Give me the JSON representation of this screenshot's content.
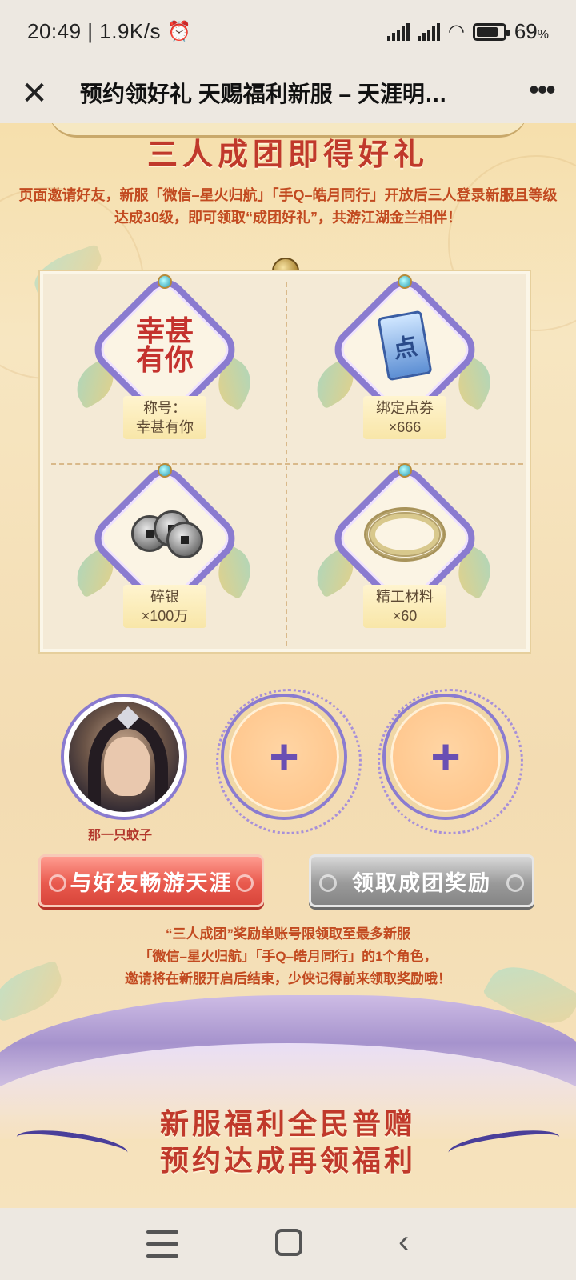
{
  "statusbar": {
    "time_speed": "20:49 | 1.9K/s",
    "alarm_icon": "alarm-clock-icon",
    "battery_pct": "69",
    "battery_unit": "%"
  },
  "navbar": {
    "close_glyph": "✕",
    "title": "预约领好礼 天赐福利新服 – 天涯明…",
    "more_glyph": "•••"
  },
  "page": {
    "section_title": "三人成团即得好礼",
    "description": "页面邀请好友，新服「微信–星火归航」「手Q–皓月同行」开放后三人登录新服且等级达成30级，即可领取“成团好礼”，共游江湖金兰相伴！",
    "rewards": [
      {
        "icon": "title-calligraphy-icon",
        "icon_text": "幸甚\n有你",
        "line1": "称号：",
        "line2": "幸甚有你"
      },
      {
        "icon": "scroll-coupon-icon",
        "icon_text": "点",
        "line1": "绑定点券",
        "line2": "×666"
      },
      {
        "icon": "silver-coins-icon",
        "line1": "碎银",
        "line2": "×100万"
      },
      {
        "icon": "rope-material-icon",
        "line1": "精工材料",
        "line2": "×60"
      }
    ],
    "team": {
      "player_name": "那一只蚊子",
      "empty_slot_glyph": "+"
    },
    "buttons": {
      "invite": "与好友畅游天涯",
      "claim": "领取成团奖励"
    },
    "notice_lines": [
      "“三人成团”奖励单账号限领取至最多新服",
      "「微信–星火归航」「手Q–皓月同行」的1个角色，",
      "邀请将在新服开启后结束，少侠记得前来领取奖励哦！"
    ],
    "bottom_title_1": "新服福利全民普赠",
    "bottom_title_2": "预约达成再领福利"
  },
  "colors": {
    "accent_red": "#c0392b",
    "accent_purple": "#8a7bd0",
    "invite_button": "#e95a4e",
    "claim_button_disabled": "#9a9a9a"
  }
}
